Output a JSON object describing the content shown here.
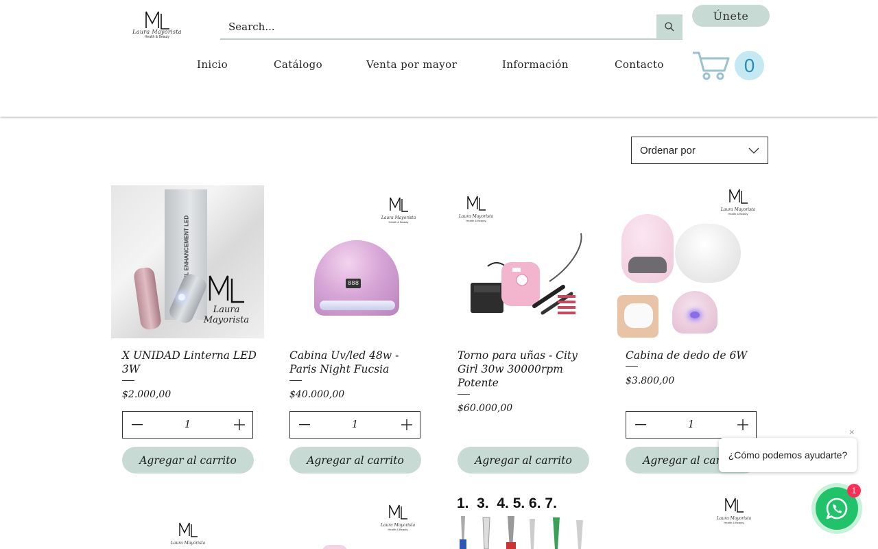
{
  "header": {
    "logo": {
      "monogram": "ML",
      "brand": "Laura Mayorista",
      "tagline": "Health & Beauty"
    },
    "search": {
      "placeholder": "Search..."
    },
    "join_label": "Únete",
    "nav": [
      "Inicio",
      "Catálogo",
      "Venta por mayor",
      "Información",
      "Contacto"
    ],
    "cart_count": "0"
  },
  "sort": {
    "label": "Ordenar por"
  },
  "products": [
    {
      "name": "X UNIDAD Linterna LED 3W",
      "price": "$2.000,00",
      "qty": "1",
      "add_label": "Agregar al carrito",
      "image_text": "NAIL ENHANCEMENT LED"
    },
    {
      "name": "Cabina Uv/led 48w - Paris Night Fucsia",
      "price": "$40.000,00",
      "qty": "1",
      "add_label": "Agregar al carrito",
      "image_text": "888"
    },
    {
      "name": "Torno para uñas -  City Girl 30w 30000rpm Potente",
      "price": "$60.000,00",
      "qty": "",
      "add_label": "Agregar al carrito",
      "image_text": ""
    },
    {
      "name": "Cabina de dedo de 6W",
      "price": "$3.800,00",
      "qty": "1",
      "add_label": "Agregar al carrito",
      "image_text": ""
    }
  ],
  "row2": {
    "bits_label": "1.  3.  4. 5. 6. 7."
  },
  "chat": {
    "close": "×",
    "message": "¿Cómo podemos ayudarte?",
    "badge": "1"
  },
  "colors": {
    "accent": "#c7dbd4",
    "cart_badge": "#c5e9f2",
    "whatsapp": "#21c36a",
    "notify": "#ff2d55"
  }
}
